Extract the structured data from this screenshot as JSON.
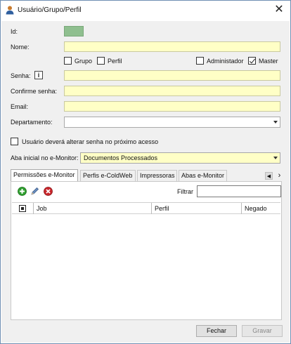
{
  "window": {
    "title": "Usuário/Grupo/Perfil",
    "close_glyph": "✕"
  },
  "form": {
    "id_label": "Id:",
    "nome_label": "Nome:",
    "grupo_label": "Grupo",
    "perfil_label": "Perfil",
    "administador_label": "Administador",
    "master_label": "Master",
    "master_checked": true,
    "grupo_checked": false,
    "perfil_checked": false,
    "administador_checked": false,
    "senha_label": "Senha:",
    "info_glyph": "i",
    "confirme_label": "Confirme senha:",
    "email_label": "Email:",
    "departamento_label": "Departamento:",
    "alterar_senha_label": "Usuário deverá alterar senha no próximo acesso",
    "alterar_senha_checked": false,
    "aba_inicial_label": "Aba inicial no e-Monitor:",
    "aba_inicial_value": "Documentos Processados"
  },
  "tabs": [
    {
      "label": "Permissões e-Monitor",
      "active": true
    },
    {
      "label": "Perfis e-ColdWeb",
      "active": false
    },
    {
      "label": "Impressoras",
      "active": false
    },
    {
      "label": "Abas e-Monitor",
      "active": false
    }
  ],
  "tab_scroll": {
    "left": "◀",
    "right": "›"
  },
  "toolbar": {
    "filter_label": "Filtrar",
    "filter_value": ""
  },
  "grid": {
    "columns": [
      "Job",
      "Perfil",
      "Negado"
    ],
    "rows": []
  },
  "buttons": {
    "fechar": "Fechar",
    "gravar": "Gravar"
  },
  "icons": {
    "title": "user-icon",
    "add": "add-icon",
    "edit": "pencil-icon",
    "delete": "delete-icon"
  },
  "colors": {
    "input_yellow": "#ffffc6",
    "id_green": "#8fbf8f",
    "add_green": "#2e9e2e",
    "delete_red": "#c8262b"
  }
}
